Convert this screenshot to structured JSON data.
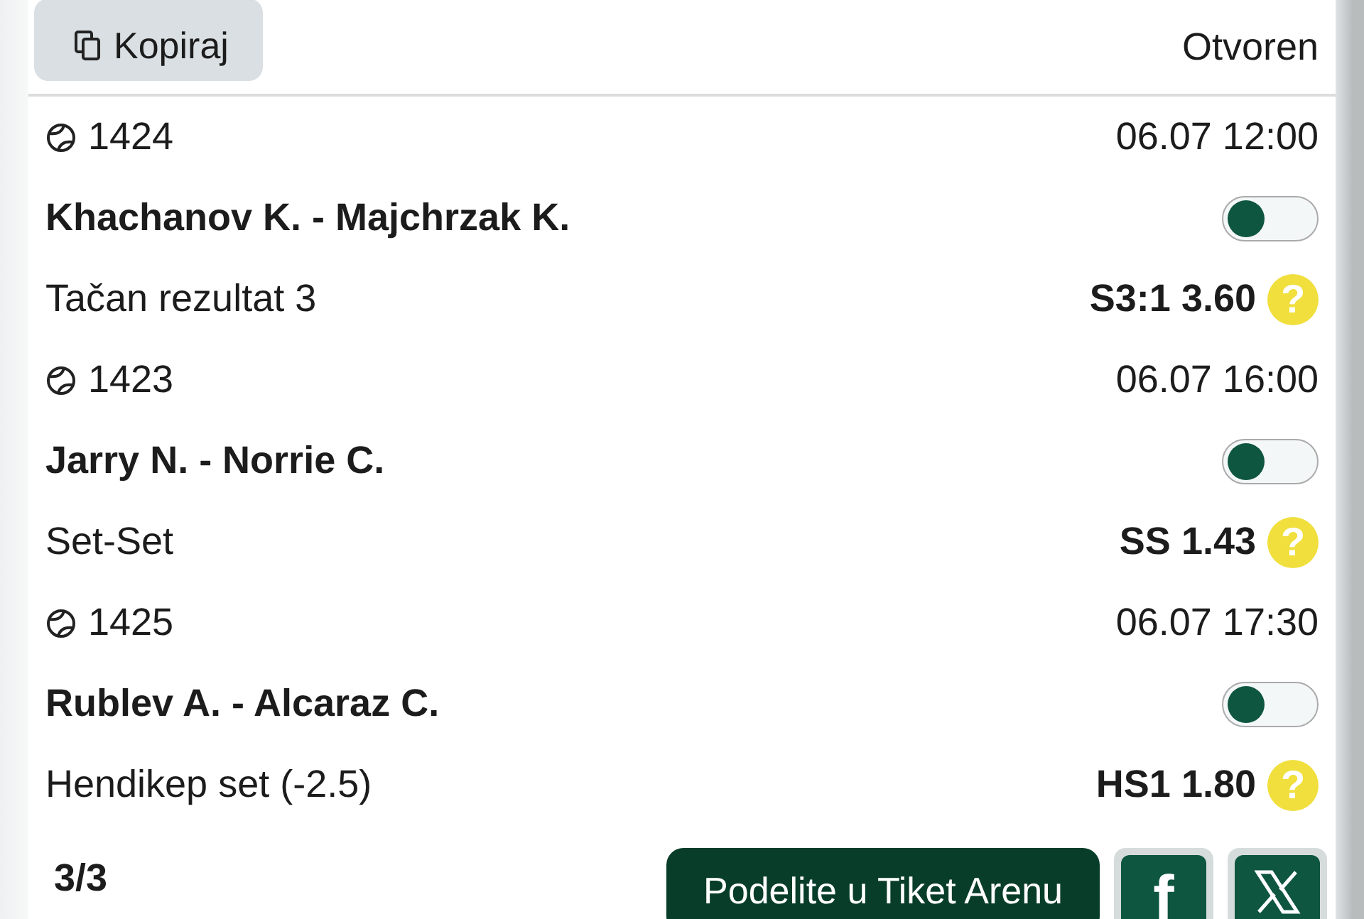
{
  "header": {
    "copy_button": "Kopiraj",
    "status": "Otvoren"
  },
  "matches": [
    {
      "code": "1424",
      "time": "06.07 12:00",
      "teams": "Khachanov K. - Majchrzak K.",
      "on": false,
      "market": "Tačan rezultat 3",
      "pick": "S3:1 3.60",
      "help": "?"
    },
    {
      "code": "1423",
      "time": "06.07 16:00",
      "teams": "Jarry N. - Norrie C.",
      "on": false,
      "market": "Set-Set",
      "pick": "SS 1.43",
      "help": "?"
    },
    {
      "code": "1425",
      "time": "06.07 17:30",
      "teams": "Rublev A. - Alcaraz C.",
      "on": false,
      "market": "Hendikep set (-2.5)",
      "pick": "HS1 1.80",
      "help": "?"
    }
  ],
  "footer": {
    "count": "3/3",
    "share_button": "Podelite u Tiket Arenu",
    "facebook": "f"
  }
}
